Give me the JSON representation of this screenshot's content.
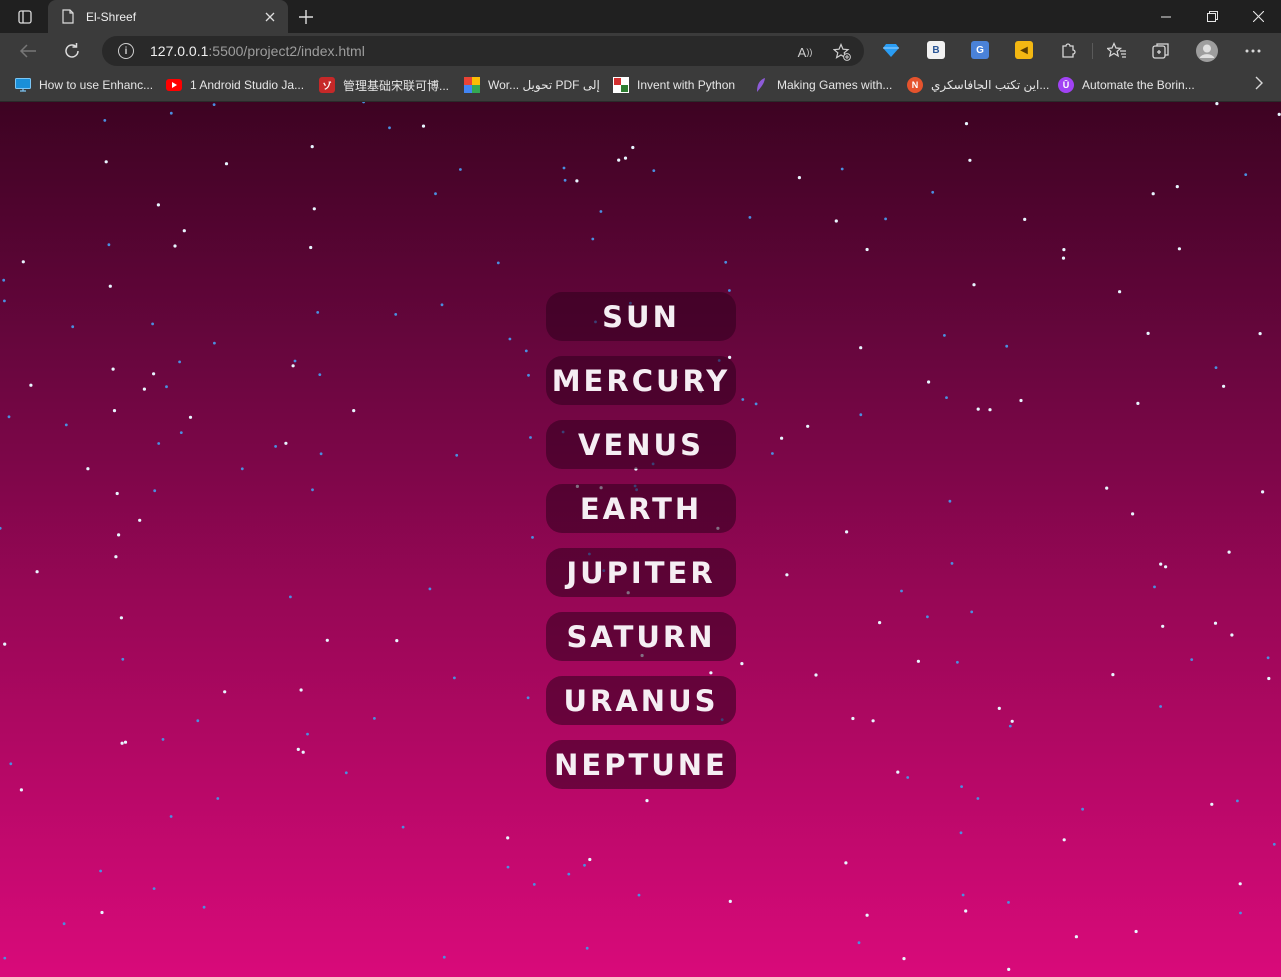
{
  "browser": {
    "tab": {
      "title": "El-Shreef",
      "favicon": "page-icon"
    },
    "address": {
      "host": "127.0.0.1",
      "rest": ":5500/project2/index.html"
    },
    "bookmarks": [
      {
        "label": "How to use Enhanc...",
        "icon": "monitor-icon",
        "color": "#1a8fd8"
      },
      {
        "label": "1 Android Studio Ja...",
        "icon": "youtube-icon",
        "color": "#ff0000"
      },
      {
        "label": "管理基础宋联可博...",
        "icon": "red-logo-icon",
        "color": "#c62828"
      },
      {
        "label": "Wor... تحويل PDF إلى",
        "icon": "colorful-grid-icon",
        "color": "#f4b400"
      },
      {
        "label": "Invent with Python",
        "icon": "python-book-icon",
        "color": "#d32f2f"
      },
      {
        "label": "Making Games with...",
        "icon": "feather-icon",
        "color": "#8e5bd9"
      },
      {
        "label": "اين تكتب الجافاسكري...",
        "icon": "n-logo-icon",
        "color": "#e5532d"
      },
      {
        "label": "Automate the Borin...",
        "icon": "u-logo-icon",
        "color": "#a142f4"
      }
    ]
  },
  "page": {
    "planets": [
      "SUN",
      "MERCURY",
      "VENUS",
      "EARTH",
      "JUPITER",
      "SATURN",
      "URANUS",
      "NEPTUNE"
    ]
  },
  "colors": {
    "gradient_top": "#3d0322",
    "gradient_bottom": "#d90a7a",
    "star_white": "#e8f6ff",
    "star_blue": "#4a8fe0"
  }
}
